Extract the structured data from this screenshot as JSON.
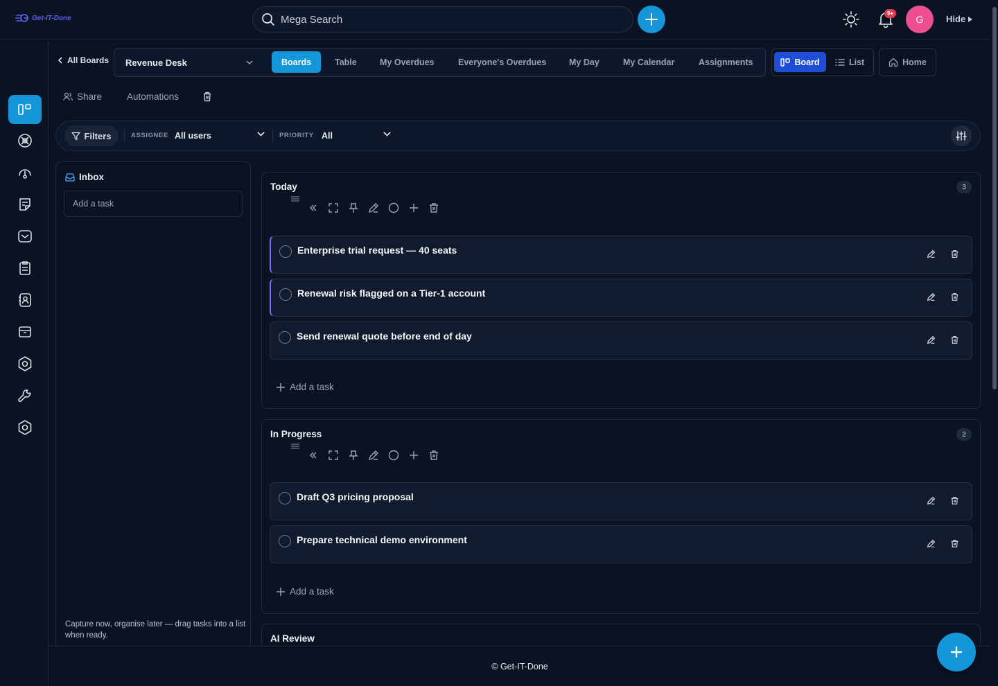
{
  "app": {
    "logo_text": "Get-IT-Done"
  },
  "header": {
    "search_placeholder": "Mega Search",
    "notifications_badge": "9+",
    "avatar_initial": "G",
    "hide_label": "Hide"
  },
  "board_nav": {
    "back_label": "All Boards",
    "board_name": "Revenue Desk",
    "tabs": [
      {
        "label": "Boards",
        "active": true
      },
      {
        "label": "Table"
      },
      {
        "label": "My Overdues"
      },
      {
        "label": "Everyone's Overdues"
      },
      {
        "label": "My Day"
      },
      {
        "label": "My Calendar"
      },
      {
        "label": "Assignments"
      }
    ],
    "view_board_label": "Board",
    "view_list_label": "List",
    "home_label": "Home"
  },
  "actions": {
    "share_label": "Share",
    "automations_label": "Automations"
  },
  "filters": {
    "button_label": "Filters",
    "assignee_label": "ASSIGNEE",
    "assignee_value": "All users",
    "priority_label": "PRIORITY",
    "priority_value": "All"
  },
  "inbox": {
    "title": "Inbox",
    "add_placeholder": "Add a task",
    "hint": "Capture now, organise later — drag tasks into a list when ready."
  },
  "columns": [
    {
      "title": "Today",
      "count": "3",
      "tasks": [
        {
          "title": "Enterprise trial request — 40 seats",
          "accent": true
        },
        {
          "title": "Renewal risk flagged on a Tier-1 account",
          "accent": true
        },
        {
          "title": "Send renewal quote before end of day",
          "accent": false
        }
      ],
      "add_label": "Add a task"
    },
    {
      "title": "In Progress",
      "count": "2",
      "tasks": [
        {
          "title": "Draft Q3 pricing proposal",
          "accent": false
        },
        {
          "title": "Prepare technical demo environment",
          "accent": false
        }
      ],
      "add_label": "Add a task"
    },
    {
      "title": "AI Review"
    }
  ],
  "footer": {
    "text": "© Get-IT-Done"
  },
  "colors": {
    "accent": "#1596d9",
    "board_view": "#1e4ed8",
    "avatar": "#ee4e8f",
    "badge": "#e53950",
    "task_accent": "#7c6cf0"
  },
  "sidebar_icons": [
    "boards-icon",
    "integrations-icon",
    "dashboard-icon",
    "notes-icon",
    "inbox-icon",
    "clipboard-icon",
    "contacts-icon",
    "archive-icon",
    "automation-icon",
    "tools-icon",
    "settings-icon"
  ]
}
